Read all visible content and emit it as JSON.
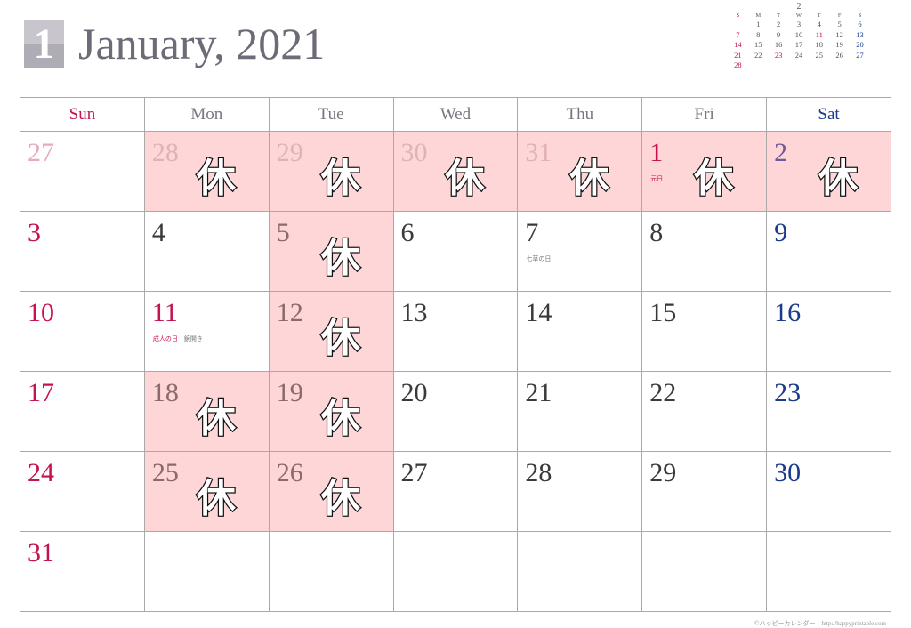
{
  "header": {
    "month_number": "1",
    "title": "January, 2021"
  },
  "mini_calendar": {
    "month": "2",
    "weekday_headers": [
      "S",
      "M",
      "T",
      "W",
      "T",
      "F",
      "S"
    ],
    "weeks": [
      [
        "",
        "1",
        "2",
        "3",
        "4",
        "5",
        "6"
      ],
      [
        "7",
        "8",
        "9",
        "10",
        "11",
        "12",
        "13"
      ],
      [
        "14",
        "15",
        "16",
        "17",
        "18",
        "19",
        "20"
      ],
      [
        "21",
        "22",
        "23",
        "24",
        "25",
        "26",
        "27"
      ],
      [
        "28",
        "",
        "",
        "",
        "",
        "",
        ""
      ]
    ],
    "holidays": [
      "11",
      "23"
    ]
  },
  "calendar": {
    "weekdays": [
      "Sun",
      "Mon",
      "Tue",
      "Wed",
      "Thu",
      "Fri",
      "Sat"
    ],
    "closed_mark": "休",
    "weeks": [
      [
        {
          "day": "27",
          "other_month": true,
          "closed": false
        },
        {
          "day": "28",
          "other_month": true,
          "closed": true
        },
        {
          "day": "29",
          "other_month": true,
          "closed": true
        },
        {
          "day": "30",
          "other_month": true,
          "closed": true
        },
        {
          "day": "31",
          "other_month": true,
          "closed": true
        },
        {
          "day": "1",
          "holiday": true,
          "note": "元日",
          "closed": true
        },
        {
          "day": "2",
          "closed": true
        }
      ],
      [
        {
          "day": "3"
        },
        {
          "day": "4"
        },
        {
          "day": "5",
          "closed": true
        },
        {
          "day": "6"
        },
        {
          "day": "7",
          "note": "七草の日"
        },
        {
          "day": "8"
        },
        {
          "day": "9"
        }
      ],
      [
        {
          "day": "10"
        },
        {
          "day": "11",
          "holiday": true,
          "note": "成人の日",
          "note2": "鏡開き"
        },
        {
          "day": "12",
          "closed": true
        },
        {
          "day": "13"
        },
        {
          "day": "14"
        },
        {
          "day": "15"
        },
        {
          "day": "16"
        }
      ],
      [
        {
          "day": "17"
        },
        {
          "day": "18",
          "closed": true
        },
        {
          "day": "19",
          "closed": true
        },
        {
          "day": "20"
        },
        {
          "day": "21"
        },
        {
          "day": "22"
        },
        {
          "day": "23"
        }
      ],
      [
        {
          "day": "24"
        },
        {
          "day": "25",
          "closed": true
        },
        {
          "day": "26",
          "closed": true
        },
        {
          "day": "27"
        },
        {
          "day": "28"
        },
        {
          "day": "29"
        },
        {
          "day": "30"
        }
      ],
      [
        {
          "day": "31"
        },
        {
          "day": ""
        },
        {
          "day": ""
        },
        {
          "day": ""
        },
        {
          "day": ""
        },
        {
          "day": ""
        },
        {
          "day": ""
        }
      ]
    ]
  },
  "footer": {
    "credit": "©ハッピーカレンダー　http://happyprintable.com"
  },
  "colors": {
    "sunday": "#c4134e",
    "saturday": "#1a3a8a",
    "closed_bg": "#ffd6d8",
    "title": "#6d6b78"
  }
}
